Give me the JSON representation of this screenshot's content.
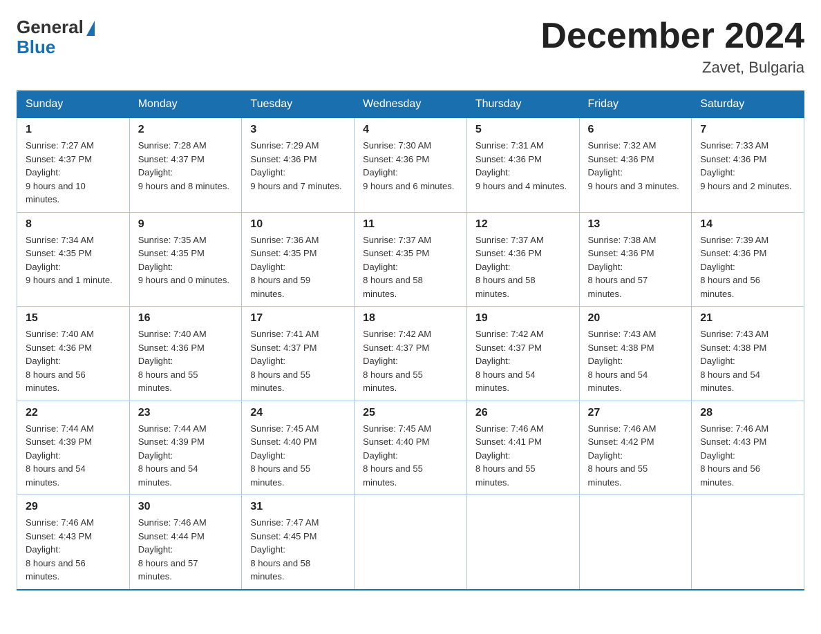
{
  "header": {
    "logo": {
      "general": "General",
      "blue": "Blue"
    },
    "title": "December 2024",
    "location": "Zavet, Bulgaria"
  },
  "days_of_week": [
    "Sunday",
    "Monday",
    "Tuesday",
    "Wednesday",
    "Thursday",
    "Friday",
    "Saturday"
  ],
  "weeks": [
    [
      {
        "day": "1",
        "sunrise": "7:27 AM",
        "sunset": "4:37 PM",
        "daylight": "9 hours and 10 minutes."
      },
      {
        "day": "2",
        "sunrise": "7:28 AM",
        "sunset": "4:37 PM",
        "daylight": "9 hours and 8 minutes."
      },
      {
        "day": "3",
        "sunrise": "7:29 AM",
        "sunset": "4:36 PM",
        "daylight": "9 hours and 7 minutes."
      },
      {
        "day": "4",
        "sunrise": "7:30 AM",
        "sunset": "4:36 PM",
        "daylight": "9 hours and 6 minutes."
      },
      {
        "day": "5",
        "sunrise": "7:31 AM",
        "sunset": "4:36 PM",
        "daylight": "9 hours and 4 minutes."
      },
      {
        "day": "6",
        "sunrise": "7:32 AM",
        "sunset": "4:36 PM",
        "daylight": "9 hours and 3 minutes."
      },
      {
        "day": "7",
        "sunrise": "7:33 AM",
        "sunset": "4:36 PM",
        "daylight": "9 hours and 2 minutes."
      }
    ],
    [
      {
        "day": "8",
        "sunrise": "7:34 AM",
        "sunset": "4:35 PM",
        "daylight": "9 hours and 1 minute."
      },
      {
        "day": "9",
        "sunrise": "7:35 AM",
        "sunset": "4:35 PM",
        "daylight": "9 hours and 0 minutes."
      },
      {
        "day": "10",
        "sunrise": "7:36 AM",
        "sunset": "4:35 PM",
        "daylight": "8 hours and 59 minutes."
      },
      {
        "day": "11",
        "sunrise": "7:37 AM",
        "sunset": "4:35 PM",
        "daylight": "8 hours and 58 minutes."
      },
      {
        "day": "12",
        "sunrise": "7:37 AM",
        "sunset": "4:36 PM",
        "daylight": "8 hours and 58 minutes."
      },
      {
        "day": "13",
        "sunrise": "7:38 AM",
        "sunset": "4:36 PM",
        "daylight": "8 hours and 57 minutes."
      },
      {
        "day": "14",
        "sunrise": "7:39 AM",
        "sunset": "4:36 PM",
        "daylight": "8 hours and 56 minutes."
      }
    ],
    [
      {
        "day": "15",
        "sunrise": "7:40 AM",
        "sunset": "4:36 PM",
        "daylight": "8 hours and 56 minutes."
      },
      {
        "day": "16",
        "sunrise": "7:40 AM",
        "sunset": "4:36 PM",
        "daylight": "8 hours and 55 minutes."
      },
      {
        "day": "17",
        "sunrise": "7:41 AM",
        "sunset": "4:37 PM",
        "daylight": "8 hours and 55 minutes."
      },
      {
        "day": "18",
        "sunrise": "7:42 AM",
        "sunset": "4:37 PM",
        "daylight": "8 hours and 55 minutes."
      },
      {
        "day": "19",
        "sunrise": "7:42 AM",
        "sunset": "4:37 PM",
        "daylight": "8 hours and 54 minutes."
      },
      {
        "day": "20",
        "sunrise": "7:43 AM",
        "sunset": "4:38 PM",
        "daylight": "8 hours and 54 minutes."
      },
      {
        "day": "21",
        "sunrise": "7:43 AM",
        "sunset": "4:38 PM",
        "daylight": "8 hours and 54 minutes."
      }
    ],
    [
      {
        "day": "22",
        "sunrise": "7:44 AM",
        "sunset": "4:39 PM",
        "daylight": "8 hours and 54 minutes."
      },
      {
        "day": "23",
        "sunrise": "7:44 AM",
        "sunset": "4:39 PM",
        "daylight": "8 hours and 54 minutes."
      },
      {
        "day": "24",
        "sunrise": "7:45 AM",
        "sunset": "4:40 PM",
        "daylight": "8 hours and 55 minutes."
      },
      {
        "day": "25",
        "sunrise": "7:45 AM",
        "sunset": "4:40 PM",
        "daylight": "8 hours and 55 minutes."
      },
      {
        "day": "26",
        "sunrise": "7:46 AM",
        "sunset": "4:41 PM",
        "daylight": "8 hours and 55 minutes."
      },
      {
        "day": "27",
        "sunrise": "7:46 AM",
        "sunset": "4:42 PM",
        "daylight": "8 hours and 55 minutes."
      },
      {
        "day": "28",
        "sunrise": "7:46 AM",
        "sunset": "4:43 PM",
        "daylight": "8 hours and 56 minutes."
      }
    ],
    [
      {
        "day": "29",
        "sunrise": "7:46 AM",
        "sunset": "4:43 PM",
        "daylight": "8 hours and 56 minutes."
      },
      {
        "day": "30",
        "sunrise": "7:46 AM",
        "sunset": "4:44 PM",
        "daylight": "8 hours and 57 minutes."
      },
      {
        "day": "31",
        "sunrise": "7:47 AM",
        "sunset": "4:45 PM",
        "daylight": "8 hours and 58 minutes."
      },
      null,
      null,
      null,
      null
    ]
  ],
  "labels": {
    "sunrise": "Sunrise:",
    "sunset": "Sunset:",
    "daylight": "Daylight:"
  }
}
